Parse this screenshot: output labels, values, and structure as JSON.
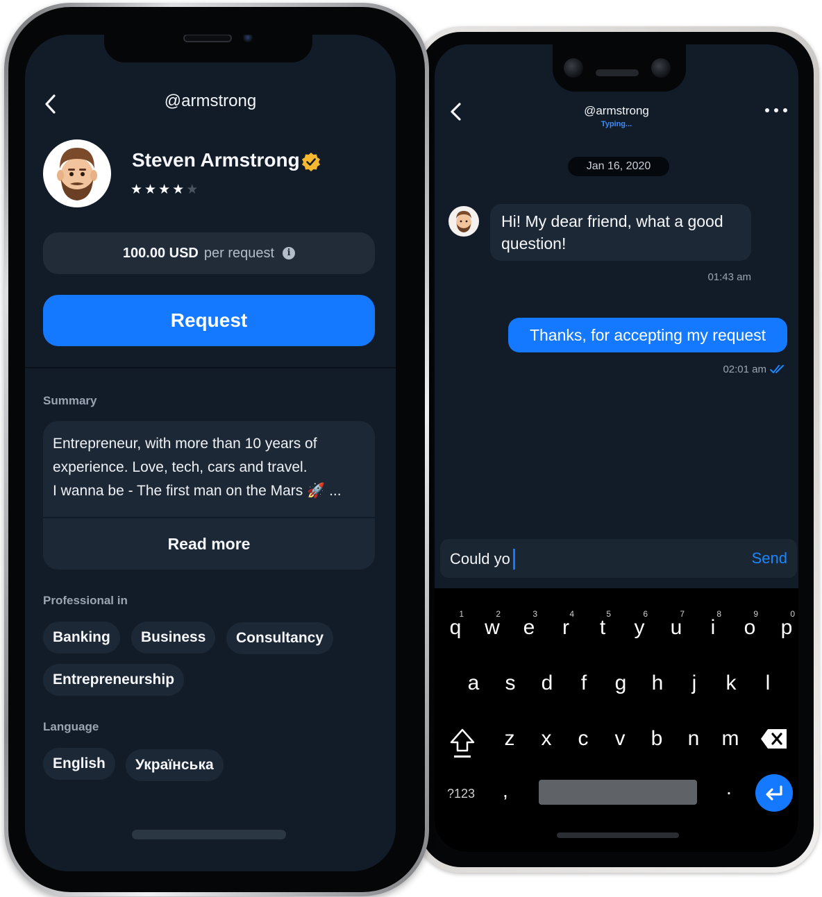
{
  "profile_screen": {
    "handle": "@armstrong",
    "name": "Steven Armstrong",
    "rating": 4,
    "rating_max": 5,
    "price_amount": "100.00 USD",
    "price_unit": "per request",
    "request_label": "Request",
    "summary_label": "Summary",
    "summary_lines": [
      "Entrepreneur, with more than 10 years of",
      "experience. Love, tech, cars and travel.",
      "I wanna be  - The first man on the Mars 🚀 ..."
    ],
    "read_more_label": "Read more",
    "professional_label": "Professional in",
    "professions": [
      "Banking",
      "Business",
      "Consultancy",
      "Entrepreneurship"
    ],
    "language_label": "Language",
    "languages": [
      "English",
      "Українська"
    ]
  },
  "chat_screen": {
    "handle": "@armstrong",
    "status": "Typing...",
    "date": "Jan 16, 2020",
    "messages": [
      {
        "direction": "incoming",
        "text": "Hi! My dear friend, what a good question!",
        "time": "01:43 am"
      },
      {
        "direction": "outgoing",
        "text": "Thanks, for accepting my request",
        "time": "02:01 am",
        "read": true
      }
    ],
    "input_value": "Could yo",
    "send_label": "Send"
  },
  "keyboard": {
    "row1": [
      {
        "key": "q",
        "hint": "1"
      },
      {
        "key": "w",
        "hint": "2"
      },
      {
        "key": "e",
        "hint": "3"
      },
      {
        "key": "r",
        "hint": "4"
      },
      {
        "key": "t",
        "hint": "5"
      },
      {
        "key": "y",
        "hint": "6"
      },
      {
        "key": "u",
        "hint": "7"
      },
      {
        "key": "i",
        "hint": "8"
      },
      {
        "key": "o",
        "hint": "9"
      },
      {
        "key": "p",
        "hint": "0"
      }
    ],
    "row2": [
      "a",
      "s",
      "d",
      "f",
      "g",
      "h",
      "j",
      "k",
      "l"
    ],
    "row3": [
      "z",
      "x",
      "c",
      "v",
      "b",
      "n",
      "m"
    ],
    "symbols_label": "?123",
    "comma": ",",
    "period": "."
  },
  "colors": {
    "background": "#121c28",
    "card": "#1d2836",
    "accent": "#1479ff",
    "verified": "#f5b82e"
  }
}
